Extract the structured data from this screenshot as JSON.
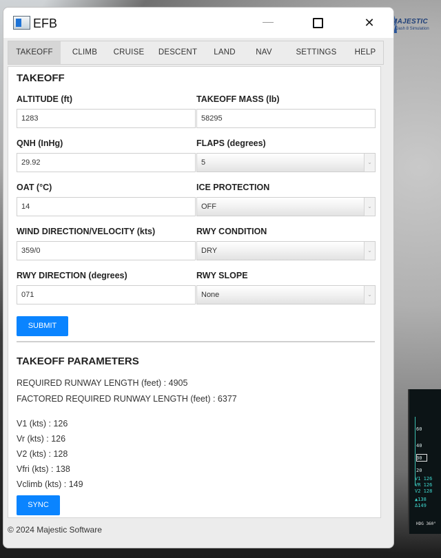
{
  "window": {
    "title": "EFB"
  },
  "background": {
    "logo_text": "MAJESTIC",
    "logo_sub": "Dash 8 Simulation",
    "pfd": {
      "ticks": [
        "60",
        "40",
        "30",
        "20"
      ],
      "speeds": [
        "V1 126",
        "VR 126",
        "V2 128",
        "▲138",
        "Δ149"
      ],
      "heading": "HDG 360°"
    }
  },
  "tabs": [
    {
      "label": "TAKEOFF",
      "active": true
    },
    {
      "label": "CLIMB"
    },
    {
      "label": "CRUISE"
    },
    {
      "label": "DESCENT"
    },
    {
      "label": "LAND"
    },
    {
      "label": "NAV"
    },
    {
      "label": "SETTINGS"
    },
    {
      "label": "HELP"
    }
  ],
  "takeoff": {
    "heading": "TAKEOFF",
    "fields": {
      "altitude": {
        "label": "ALTITUDE (ft)",
        "value": "1283"
      },
      "mass": {
        "label": "TAKEOFF MASS (lb)",
        "value": "58295"
      },
      "qnh": {
        "label": "QNH (InHg)",
        "value": "29.92"
      },
      "flaps": {
        "label": "FLAPS (degrees)",
        "value": "5"
      },
      "oat": {
        "label": "OAT (°C)",
        "value": "14"
      },
      "ice": {
        "label": "ICE PROTECTION",
        "value": "OFF"
      },
      "wind": {
        "label": "WIND DIRECTION/VELOCITY (kts)",
        "value": "359/0"
      },
      "rwy_condition": {
        "label": "RWY CONDITION",
        "value": "DRY"
      },
      "rwy_direction": {
        "label": "RWY DIRECTION (degrees)",
        "value": "071"
      },
      "rwy_slope": {
        "label": "RWY SLOPE",
        "value": "None"
      }
    },
    "submit_label": "SUBMIT"
  },
  "parameters": {
    "heading": "TAKEOFF PARAMETERS",
    "required_runway": "REQUIRED RUNWAY LENGTH (feet) : 4905",
    "factored_runway": "FACTORED REQUIRED RUNWAY LENGTH (feet) : 6377",
    "v1": "V1 (kts) : 126",
    "vr": "Vr (kts) : 126",
    "v2": "V2 (kts) : 128",
    "vfri": "Vfri (kts) : 138",
    "vclimb": "Vclimb (kts) : 149",
    "sync_label": "SYNC"
  },
  "footer": {
    "copyright": "© 2024 Majestic Software"
  },
  "icons": {
    "close": "✕",
    "caret": "⌄"
  },
  "colors": {
    "accent": "#0a84ff",
    "pfd_cyan": "#3fd9d0"
  }
}
